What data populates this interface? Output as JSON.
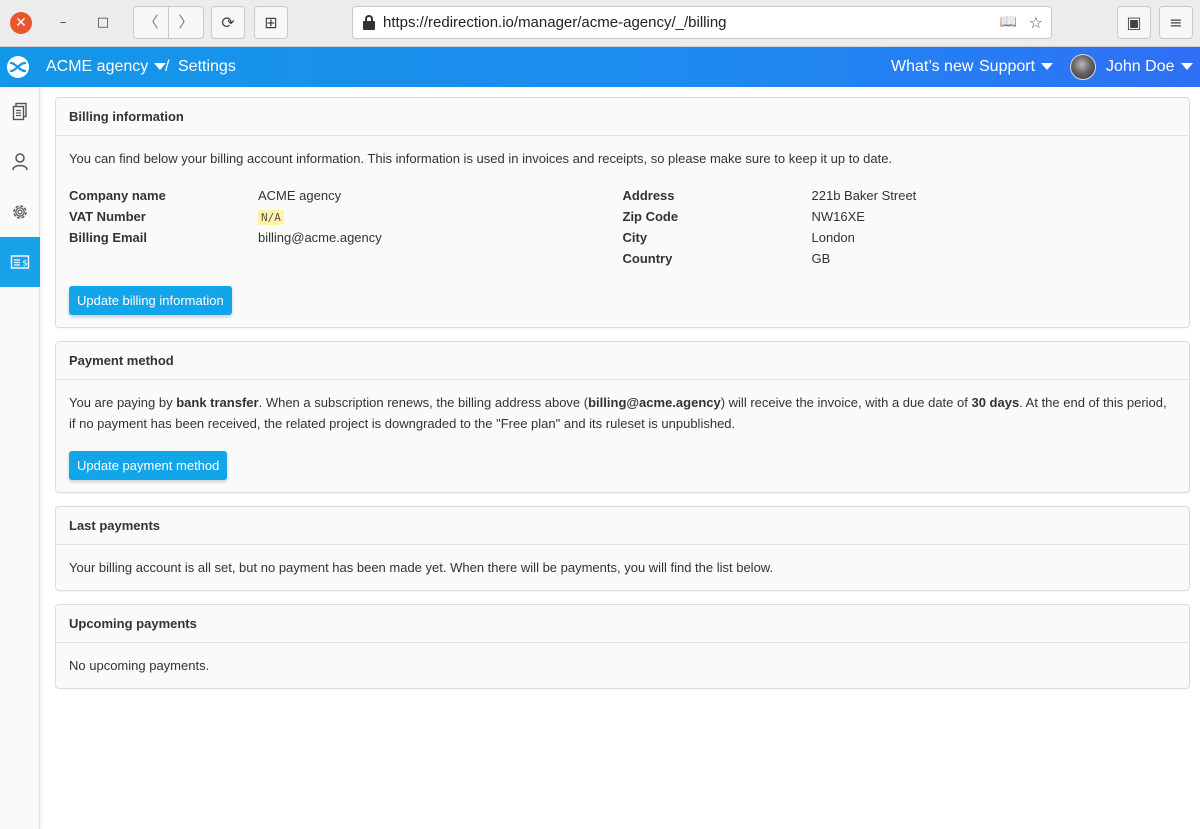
{
  "browser": {
    "url": "https://redirection.io/manager/acme-agency/_/billing",
    "close_glyph": "✕",
    "minimize_glyph": "–",
    "maximize_glyph": "□",
    "back_glyph": "〈",
    "forward_glyph": "〉",
    "reload_glyph": "⟳",
    "newtab_glyph": "⊞",
    "reader_glyph": "📖",
    "star_glyph": "☆",
    "bookmarks_glyph": "▣",
    "menu_glyph": "≡"
  },
  "header": {
    "organization": "ACME agency",
    "separator": "/",
    "breadcrumb": "Settings",
    "whats_new": "What’s new",
    "support": "Support",
    "user_name": "John Doe"
  },
  "sidebar": {
    "items": [
      {
        "name": "projects",
        "icon": "document-icon",
        "active": false
      },
      {
        "name": "account",
        "icon": "user-icon",
        "active": false
      },
      {
        "name": "settings",
        "icon": "gear-icon",
        "active": false
      },
      {
        "name": "billing",
        "icon": "billing-icon",
        "active": true
      }
    ]
  },
  "billing_info": {
    "title": "Billing information",
    "intro": "You can find below your billing account information. This information is used in invoices and receipts, so please make sure to keep it up to date.",
    "left": [
      {
        "label": "Company name",
        "value": "ACME agency"
      },
      {
        "label": "VAT Number",
        "value": "N/A"
      },
      {
        "label": "Billing Email",
        "value": "billing@acme.agency"
      }
    ],
    "right": [
      {
        "label": "Address",
        "value": "221b Baker Street"
      },
      {
        "label": "Zip Code",
        "value": "NW16XE"
      },
      {
        "label": "City",
        "value": "London"
      },
      {
        "label": "Country",
        "value": "GB"
      }
    ],
    "button": "Update billing information"
  },
  "payment_method": {
    "title": "Payment method",
    "t1": "You are paying by ",
    "method": "bank transfer",
    "t2": ". When a subscription renews, the billing address above (",
    "email": "billing@acme.agency",
    "t3": ") will receive the invoice, with a due date of ",
    "due": "30 days",
    "t4": ". At the end of this period, if no payment has been received, the related project is downgraded to the \"Free plan\" and its ruleset is unpublished.",
    "button": "Update payment method"
  },
  "last_payments": {
    "title": "Last payments",
    "text": "Your billing account is all set, but no payment has been made yet. When there will be payments, you will find the list below."
  },
  "upcoming_payments": {
    "title": "Upcoming payments",
    "text": "No upcoming payments."
  },
  "colors": {
    "accent": "#13a5ea",
    "header_start": "#1397e8",
    "header_end": "#2f6ff5",
    "close_button": "#e9552c",
    "badge_bg": "#fff3a8"
  }
}
